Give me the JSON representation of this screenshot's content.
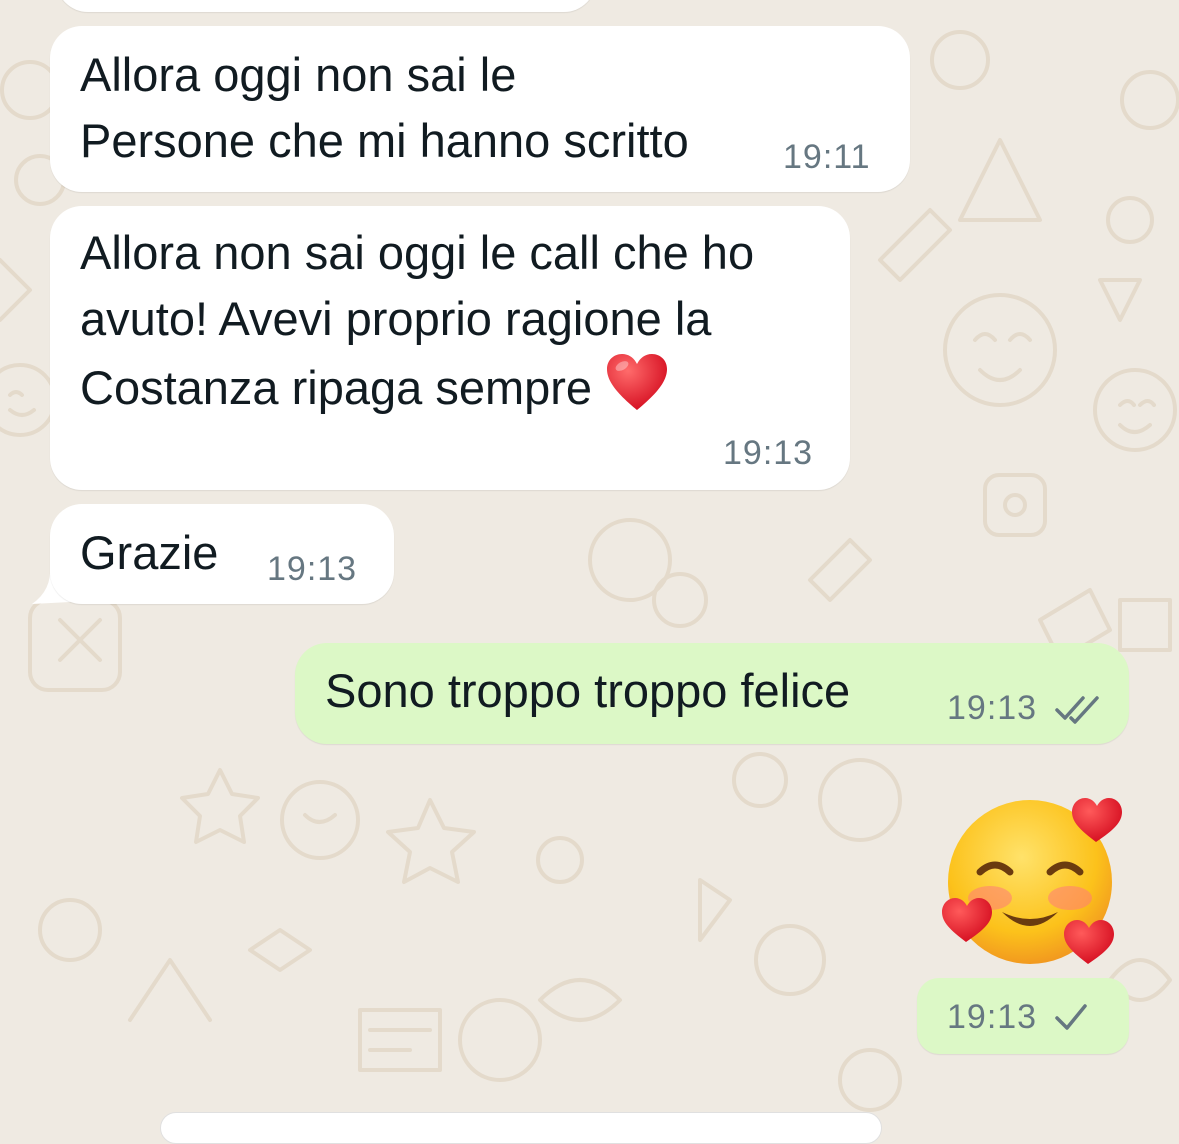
{
  "chat": {
    "messages": [
      {
        "id": "m1",
        "direction": "incoming",
        "text": "Allora oggi non sai le\nPersone che mi hanno scritto",
        "time": "19:11"
      },
      {
        "id": "m2",
        "direction": "incoming",
        "text": "Allora non sai oggi le call che ho\navuto! Avevi proprio ragione la\nCostanza ripaga sempre",
        "emoji": "red-heart",
        "time": "19:13"
      },
      {
        "id": "m3",
        "direction": "incoming",
        "text": "Grazie",
        "time": "19:13"
      },
      {
        "id": "m4",
        "direction": "outgoing",
        "text": "Sono troppo troppo felice",
        "time": "19:13",
        "status": "read",
        "status_icon": "double-check-icon"
      },
      {
        "id": "m5",
        "direction": "outgoing",
        "emoji": "smiling-face-with-hearts",
        "time": "19:13",
        "status": "sent",
        "status_icon": "single-check-icon"
      }
    ]
  },
  "colors": {
    "background": "#efeae2",
    "incoming_bubble": "#ffffff",
    "outgoing_bubble": "#dcf8c6",
    "text": "#111b21",
    "meta": "#667781"
  }
}
